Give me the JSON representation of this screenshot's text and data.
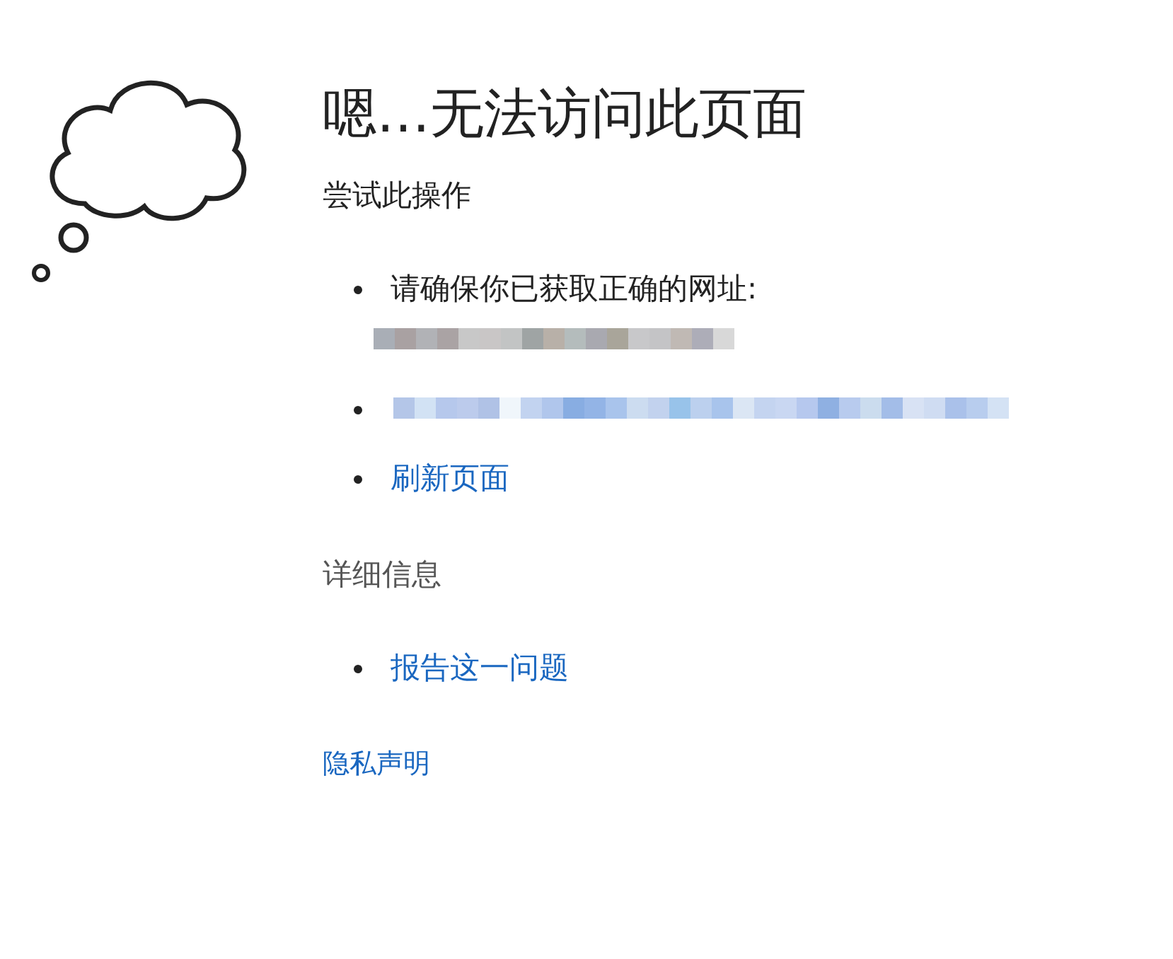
{
  "title": "嗯…无法访问此页面",
  "try_heading": "尝试此操作",
  "try_items": [
    {
      "kind": "text",
      "text": "请确保你已获取正确的网址:",
      "redacted_below": true
    },
    {
      "kind": "redacted-link"
    },
    {
      "kind": "link",
      "text": "刷新页面"
    }
  ],
  "details_heading": "详细信息",
  "details_items": [
    {
      "kind": "link",
      "text": "报告这一问题"
    }
  ],
  "footer_link": "隐私声明"
}
